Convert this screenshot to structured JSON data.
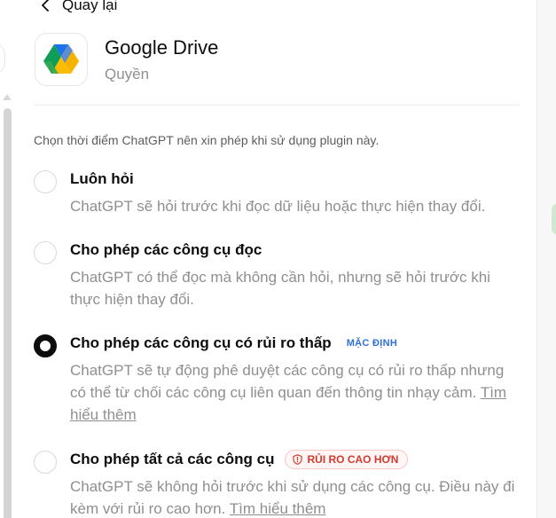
{
  "nav": {
    "back_label": "Quay lại"
  },
  "app": {
    "name": "Google Drive",
    "subtitle": "Quyền",
    "icon": "google-drive-logo"
  },
  "intro_text": "Chọn thời điểm ChatGPT nên xin phép khi sử dụng plugin này.",
  "options": [
    {
      "title": "Luôn hỏi",
      "description": "ChatGPT sẽ hỏi trước khi đọc dữ liệu hoặc thực hiện thay đổi.",
      "selected": false
    },
    {
      "title": "Cho phép các công cụ đọc",
      "description": "ChatGPT có thể đọc mà không cần hỏi, nhưng sẽ hỏi trước khi thực hiện thay đổi.",
      "selected": false
    },
    {
      "title": "Cho phép các công cụ có rủi ro thấp",
      "badge": "MẶC ĐỊNH",
      "description": "ChatGPT sẽ tự động phê duyệt các công cụ có rủi ro thấp nhưng có thể từ chối các công cụ liên quan đến thông tin nhạy cảm.",
      "link": "Tìm hiểu thêm",
      "selected": true
    },
    {
      "title": "Cho phép tất cả các công cụ",
      "badge": "RỦI RO CAO HƠN",
      "description": "ChatGPT sẽ không hỏi trước khi sử dụng các công cụ. Điều này đi kèm với rủi ro cao hơn.",
      "link": "Tìm hiểu thêm",
      "selected": false
    }
  ],
  "colors": {
    "text_primary": "#0d0d0d",
    "text_secondary": "#8f8f8f",
    "badge_default": "#2f6fdc",
    "badge_risk": "#d23a2f"
  }
}
